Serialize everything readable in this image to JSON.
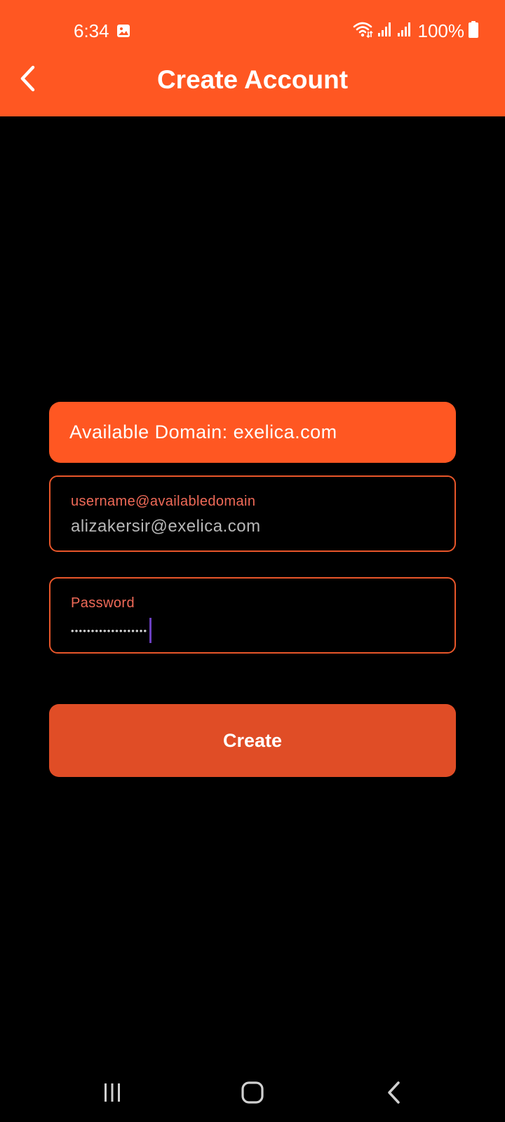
{
  "status_bar": {
    "time": "6:34",
    "battery": "100%",
    "icons": [
      "gallery-icon",
      "wifi-icon",
      "signal-icon",
      "signal-icon",
      "battery-icon"
    ]
  },
  "app_bar": {
    "title": "Create Account",
    "back_icon": "chevron-left-icon"
  },
  "form": {
    "domain_banner": "Available Domain: exelica.com",
    "email_field": {
      "label": "username@availabledomain",
      "value": "alizakersir@exelica.com"
    },
    "password_field": {
      "label": "Password",
      "masked_value": "•••••••••••••••••••"
    },
    "create_label": "Create"
  },
  "navigation_bar": {
    "icons": [
      "recents-icon",
      "home-icon",
      "back-icon"
    ]
  },
  "colors": {
    "accent": "#ff5722",
    "button": "#e04d26",
    "field_border": "#e8562a",
    "field_label": "#f06a58",
    "cursor": "#6a3fbf",
    "background": "#000000"
  }
}
